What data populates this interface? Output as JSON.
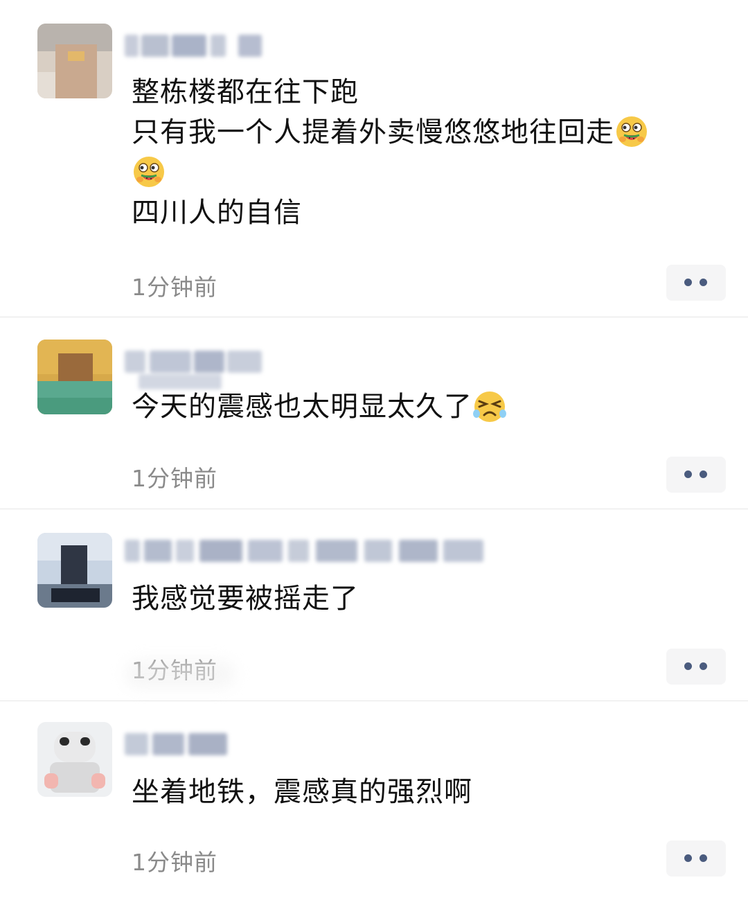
{
  "comments": [
    {
      "lines": [
        "整栋楼都在往下跑",
        "只有我一个人提着外卖慢悠悠地往回走",
        "四川人的自信"
      ],
      "time": "1分钟前",
      "emojis": [
        "watermelon-face",
        "watermelon-face"
      ]
    },
    {
      "lines": [
        "今天的震感也太明显太久了"
      ],
      "time": "1分钟前",
      "emojis": [
        "squinting-sweat-face"
      ]
    },
    {
      "lines": [
        "我感觉要被摇走了"
      ],
      "time": "1分钟前",
      "emojis": []
    },
    {
      "lines": [
        "坐着地铁，震感真的强烈啊"
      ],
      "time": "1分钟前",
      "emojis": []
    }
  ],
  "icons": {
    "more": "more-dots-icon",
    "emoji_1": "watermelon-face-emoji-icon",
    "emoji_2": "squinting-sweat-face-emoji-icon"
  },
  "colors": {
    "link_blue": "#4a5b7e",
    "time_gray": "#8a8a8a",
    "divider": "#e6e6e6",
    "more_bg": "#f5f5f6"
  }
}
